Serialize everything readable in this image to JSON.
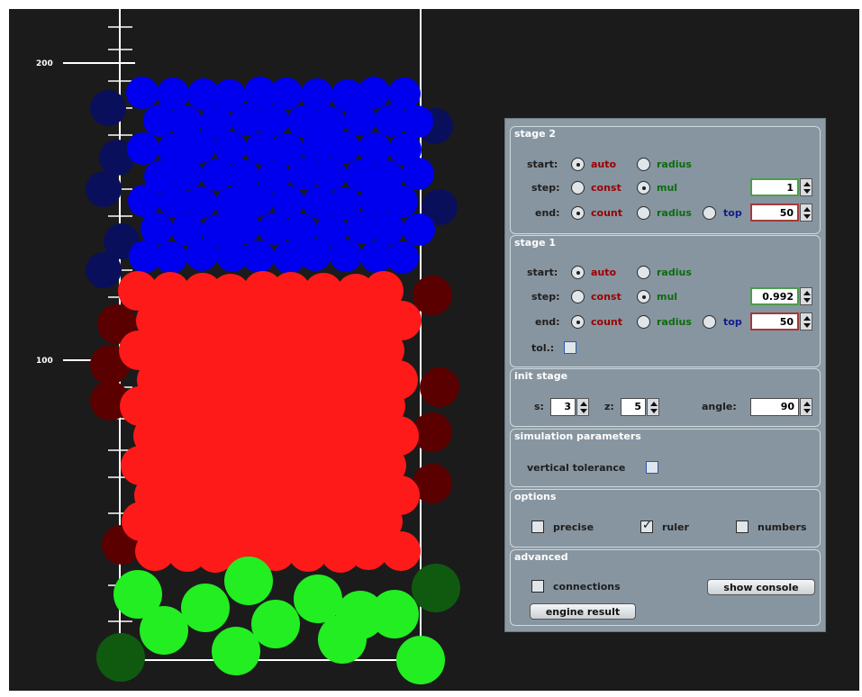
{
  "ruler": {
    "ticks": [
      "200",
      "100"
    ]
  },
  "colors": {
    "stage2": "#0000ee",
    "stage1": "#ff1a1a",
    "init": "#22ee22",
    "stage2_dim": "#0a0f5c",
    "stage1_dim": "#5a0000",
    "init_dim": "#0f5a0f"
  },
  "panel": {
    "stage2": {
      "title": "stage 2",
      "start_label": "start:",
      "start_auto": "auto",
      "start_radius": "radius",
      "step_label": "step:",
      "step_const": "const",
      "step_mul": "mul",
      "step_value": "1",
      "end_label": "end:",
      "end_count": "count",
      "end_radius": "radius",
      "end_top": "top",
      "end_value": "50"
    },
    "stage1": {
      "title": "stage 1",
      "start_label": "start:",
      "start_auto": "auto",
      "start_radius": "radius",
      "step_label": "step:",
      "step_const": "const",
      "step_mul": "mul",
      "step_value": "0.992",
      "end_label": "end:",
      "end_count": "count",
      "end_radius": "radius",
      "end_top": "top",
      "end_value": "50",
      "tol_label": "tol.:"
    },
    "init": {
      "title": "init stage",
      "s_label": "s:",
      "s_value": "3",
      "z_label": "z:",
      "z_value": "5",
      "angle_label": "angle:",
      "angle_value": "90"
    },
    "sim": {
      "title": "simulation parameters",
      "vertical_tolerance": "vertical tolerance"
    },
    "options": {
      "title": "options",
      "precise": "precise",
      "ruler": "ruler",
      "numbers": "numbers"
    },
    "advanced": {
      "title": "advanced",
      "connections": "connections",
      "show_console": "show console",
      "engine_result": "engine result"
    }
  }
}
